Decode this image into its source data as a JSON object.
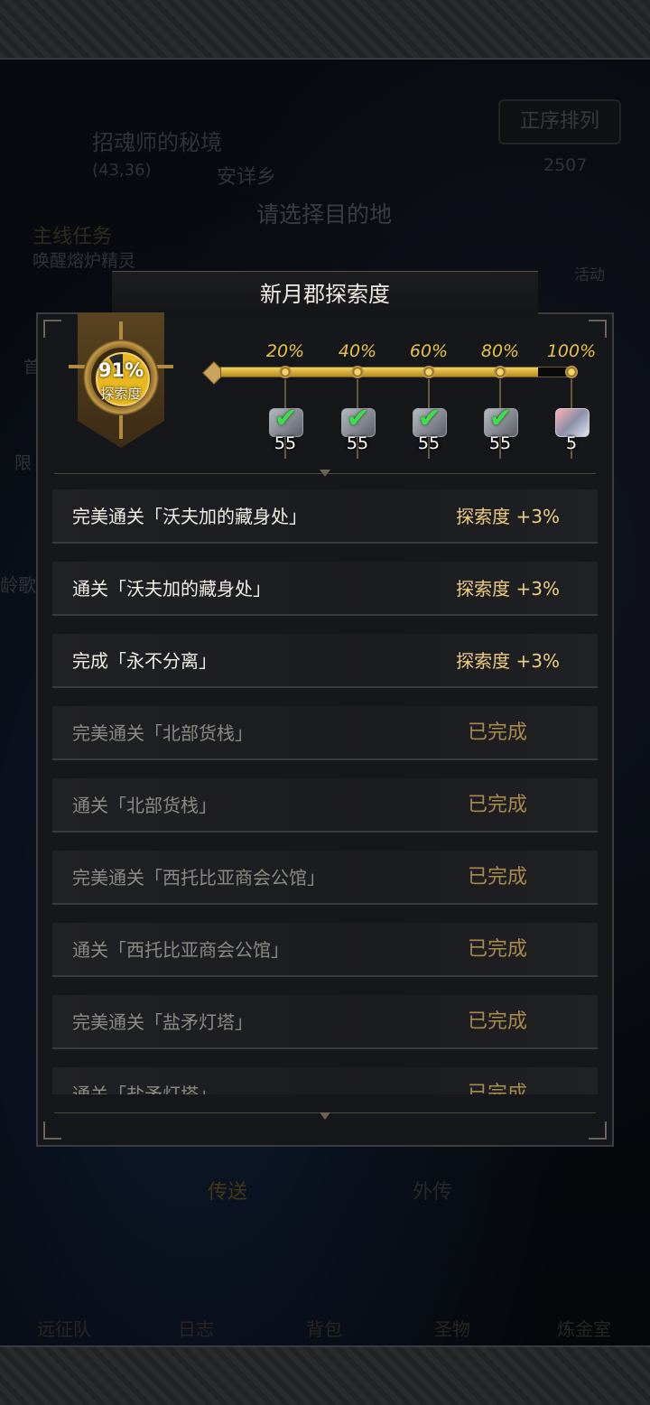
{
  "background": {
    "location_name": "招魂师的秘境",
    "coords": "(43,36)",
    "npc_name": "安详乡",
    "prompt": "请选择目的地",
    "quest_label": "主线任务",
    "quest_text": "唤醒熔炉精灵",
    "sort_button": "正序排列",
    "currency": "2507",
    "event_label": "活动",
    "side_left_1": "限",
    "side_left_2": "龄歌",
    "side_left_3": "首",
    "tabs": {
      "teleport": "传送",
      "side_story": "外传"
    },
    "nav": [
      "远征队",
      "日志",
      "背包",
      "圣物",
      "炼金室"
    ]
  },
  "modal": {
    "title": "新月郡探索度",
    "progress": {
      "percent_text": "91%",
      "label": "探索度",
      "value": 0.91
    },
    "milestones": [
      {
        "pct": "20%",
        "count": "55",
        "claimed": true,
        "icon": "ore-chunk-icon"
      },
      {
        "pct": "40%",
        "count": "55",
        "claimed": true,
        "icon": "ore-chunk-icon"
      },
      {
        "pct": "60%",
        "count": "55",
        "claimed": true,
        "icon": "ore-chunk-icon"
      },
      {
        "pct": "80%",
        "count": "55",
        "claimed": true,
        "icon": "ore-chunk-icon"
      },
      {
        "pct": "100%",
        "count": "5",
        "claimed": false,
        "icon": "crystal-icon"
      }
    ],
    "tasks": [
      {
        "name": "完美通关「沃夫加的藏身处」",
        "reward": "探索度 +3%",
        "status": "pending"
      },
      {
        "name": "通关「沃夫加的藏身处」",
        "reward": "探索度 +3%",
        "status": "pending"
      },
      {
        "name": "完成「永不分离」",
        "reward": "探索度 +3%",
        "status": "pending"
      },
      {
        "name": "完美通关「北部货栈」",
        "reward": "已完成",
        "status": "done"
      },
      {
        "name": "通关「北部货栈」",
        "reward": "已完成",
        "status": "done"
      },
      {
        "name": "完美通关「西托比亚商会公馆」",
        "reward": "已完成",
        "status": "done"
      },
      {
        "name": "通关「西托比亚商会公馆」",
        "reward": "已完成",
        "status": "done"
      },
      {
        "name": "完美通关「盐矛灯塔」",
        "reward": "已完成",
        "status": "done"
      },
      {
        "name": "通关「盐矛灯塔」",
        "reward": "已完成",
        "status": "done"
      }
    ]
  }
}
